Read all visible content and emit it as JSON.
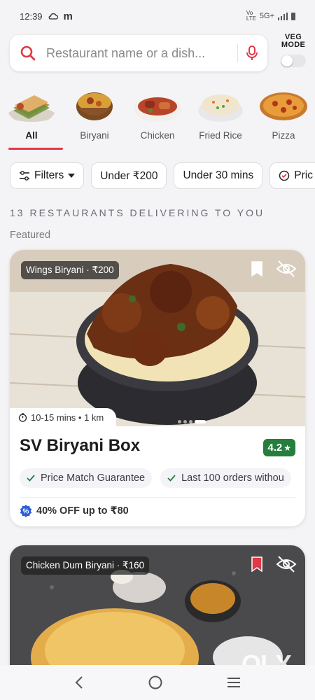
{
  "status_bar": {
    "time": "12:39",
    "carrier_badge": "m",
    "network": "5G+",
    "colors": {
      "text": "#333333"
    }
  },
  "search": {
    "placeholder": "Restaurant name or a dish...",
    "icon": "search-icon",
    "mic_icon": "mic-icon",
    "accent": "#e23744"
  },
  "veg_mode": {
    "line1": "VEG",
    "line2": "MODE",
    "enabled": false
  },
  "categories": [
    {
      "label": "All",
      "active": true
    },
    {
      "label": "Biryani",
      "active": false
    },
    {
      "label": "Chicken",
      "active": false
    },
    {
      "label": "Fried Rice",
      "active": false
    },
    {
      "label": "Pizza",
      "active": false
    }
  ],
  "filters": [
    {
      "label": "Filters",
      "icon": "sliders-icon"
    },
    {
      "label": "Under ₹200"
    },
    {
      "label": "Under 30 mins"
    },
    {
      "label": "Pric"
    }
  ],
  "section_title": "13 RESTAURANTS DELIVERING TO YOU",
  "featured_label": "Featured",
  "restaurants": [
    {
      "dish_tag": "Wings Biryani · ₹200",
      "delivery": "10-15 mins • 1 km",
      "name": "SV Biryani Box",
      "rating": "4.2",
      "features": [
        "Price Match Guarantee",
        "Last 100 orders withou"
      ],
      "offer": "40% OFF up to ₹80",
      "bookmarked": false
    },
    {
      "dish_tag": "Chicken Dum Biryani · ₹160",
      "bookmarked": true
    }
  ],
  "watermark": "OLX",
  "colors": {
    "accent": "#e23744",
    "rating_green": "#257e3e",
    "offer_blue": "#2b5fd9"
  }
}
